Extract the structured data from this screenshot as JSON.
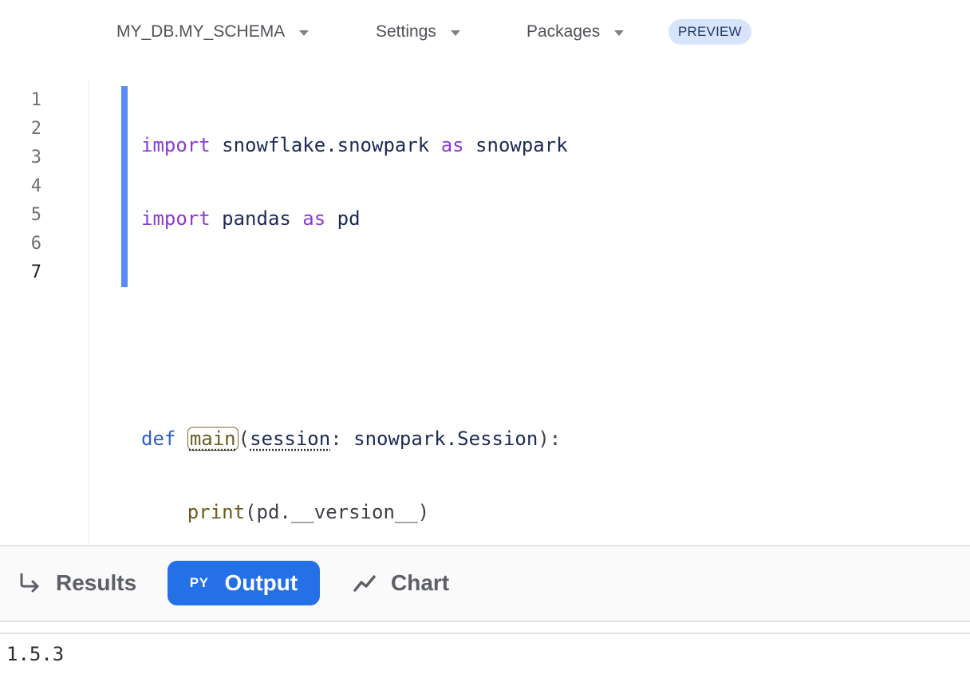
{
  "toolbar": {
    "database_schema": "MY_DB.MY_SCHEMA",
    "settings_label": "Settings",
    "packages_label": "Packages",
    "preview_badge": "PREVIEW"
  },
  "editor": {
    "line_numbers": [
      "1",
      "2",
      "3",
      "4",
      "5",
      "6",
      "7"
    ],
    "active_line": "7",
    "code": {
      "line1": {
        "kw1": "import",
        "mod": " snowflake.snowpark ",
        "kw2": "as",
        "alias": " snowpark"
      },
      "line2": {
        "kw1": "import",
        "mod": " pandas ",
        "kw2": "as",
        "alias": " pd"
      },
      "line5": {
        "def": "def",
        "fname": "main",
        "open": "(",
        "param": "session",
        "colon": ": ",
        "type": "snowpark.Session",
        "close": "):"
      },
      "line6": {
        "indent": "    ",
        "fn": "print",
        "args": "(pd.__version__)"
      }
    }
  },
  "results_tabs": {
    "results_label": "Results",
    "output_prefix": "PY",
    "output_label": "Output",
    "chart_label": "Chart",
    "active_tab": "Output"
  },
  "output": {
    "text": "1.5.3"
  },
  "colors": {
    "accent": "#2470e6",
    "change_bar": "#5a8cf7",
    "keyword": "#8b3ad6",
    "def_keyword": "#2e5fc9",
    "function": "#6b5a20",
    "preview_badge_bg": "#d7e4fb"
  }
}
